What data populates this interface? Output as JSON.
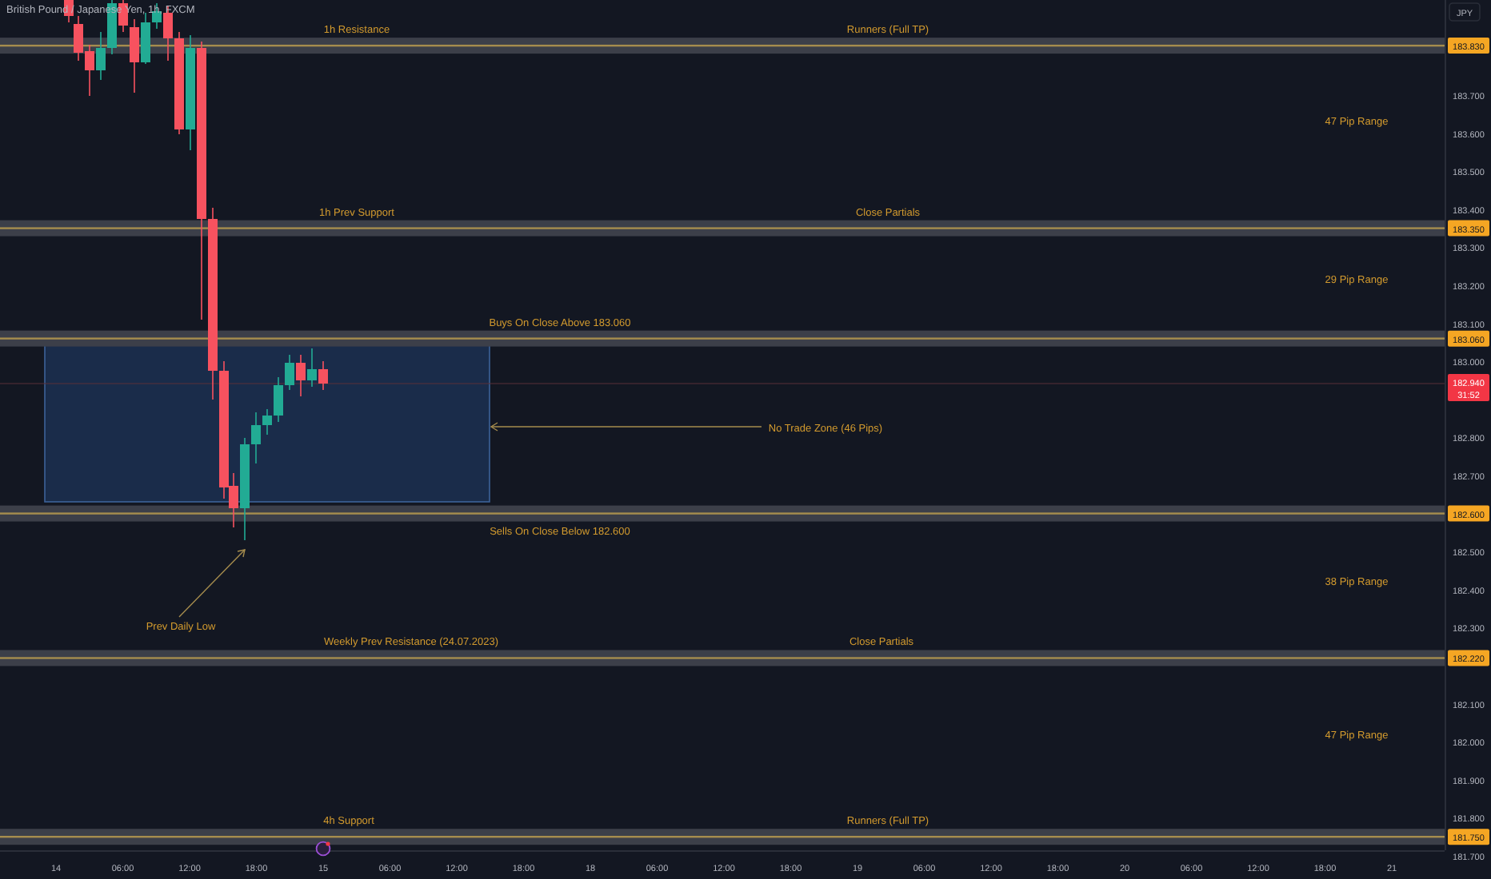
{
  "chart": {
    "title": "British Pound / Japanese Yen, 1h, FXCM",
    "currency": "JPY",
    "levels": [
      {
        "price_label": "183.830",
        "left_label": "1h Resistance",
        "right_label": "Runners (Full TP)"
      },
      {
        "price_label": "183.350",
        "left_label": "1h Prev Support",
        "right_label": "Close Partials"
      },
      {
        "price_label": "183.060",
        "left_label": "Buys On Close Above 183.060"
      },
      {
        "price_label": "182.600",
        "left_label": "Sells On Close Below 182.600"
      },
      {
        "price_label": "182.220",
        "left_label": "Weekly Prev Resistance (24.07.2023)",
        "right_label": "Close Partials"
      },
      {
        "price_label": "181.750",
        "left_label": "4h Support",
        "right_label": "Runners (Full TP)"
      }
    ],
    "range_labels": [
      "47 Pip Range",
      "29 Pip Range",
      "38 Pip Range",
      "47 Pip Range"
    ],
    "zone": {
      "label": "No Trade Zone (46 Pips)"
    },
    "annotation": "Prev Daily Low",
    "price_axis": [
      "183.700",
      "183.600",
      "183.500",
      "183.400",
      "183.300",
      "183.200",
      "183.100",
      "183.000",
      "182.800",
      "182.700",
      "182.500",
      "182.400",
      "182.300",
      "182.100",
      "182.000",
      "181.900",
      "181.800",
      "181.700"
    ],
    "current_price": {
      "price": "182.940",
      "countdown": "31:52"
    },
    "time_axis": [
      "14",
      "06:00",
      "12:00",
      "18:00",
      "15",
      "06:00",
      "12:00",
      "18:00",
      "18",
      "06:00",
      "12:00",
      "18:00",
      "19",
      "06:00",
      "12:00",
      "18:00",
      "20",
      "06:00",
      "12:00",
      "18:00",
      "21"
    ]
  }
}
